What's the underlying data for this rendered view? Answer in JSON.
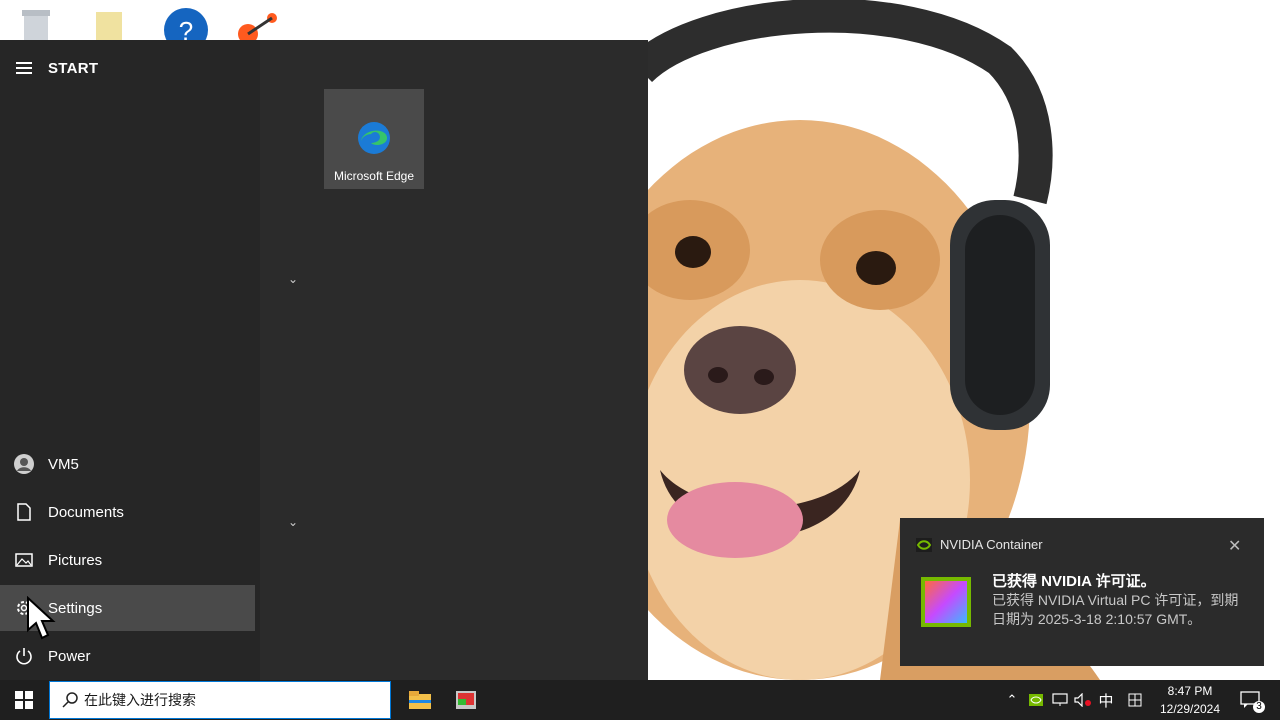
{
  "start_menu": {
    "title": "START",
    "rail": {
      "user": "VM5",
      "documents": "Documents",
      "pictures": "Pictures",
      "settings": "Settings",
      "power": "Power"
    },
    "tiles": [
      {
        "label": "Microsoft Edge",
        "icon": "edge-icon"
      }
    ]
  },
  "toast": {
    "app_name": "NVIDIA Container",
    "title": "已获得 NVIDIA 许可证。",
    "body": "已获得 NVIDIA Virtual PC 许可证，到期日期为 2025-3-18 2:10:57 GMT。"
  },
  "taskbar": {
    "search_placeholder": "在此键入进行搜索",
    "ime": "中",
    "time": "8:47 PM",
    "date": "12/29/2024",
    "notification_count": "3"
  },
  "colors": {
    "start_bg": "#2b2b2b",
    "rail_bg": "#262626",
    "taskbar_bg": "#1f1f1f",
    "accent": "#0078d7",
    "nvidia_green": "#76b900"
  }
}
